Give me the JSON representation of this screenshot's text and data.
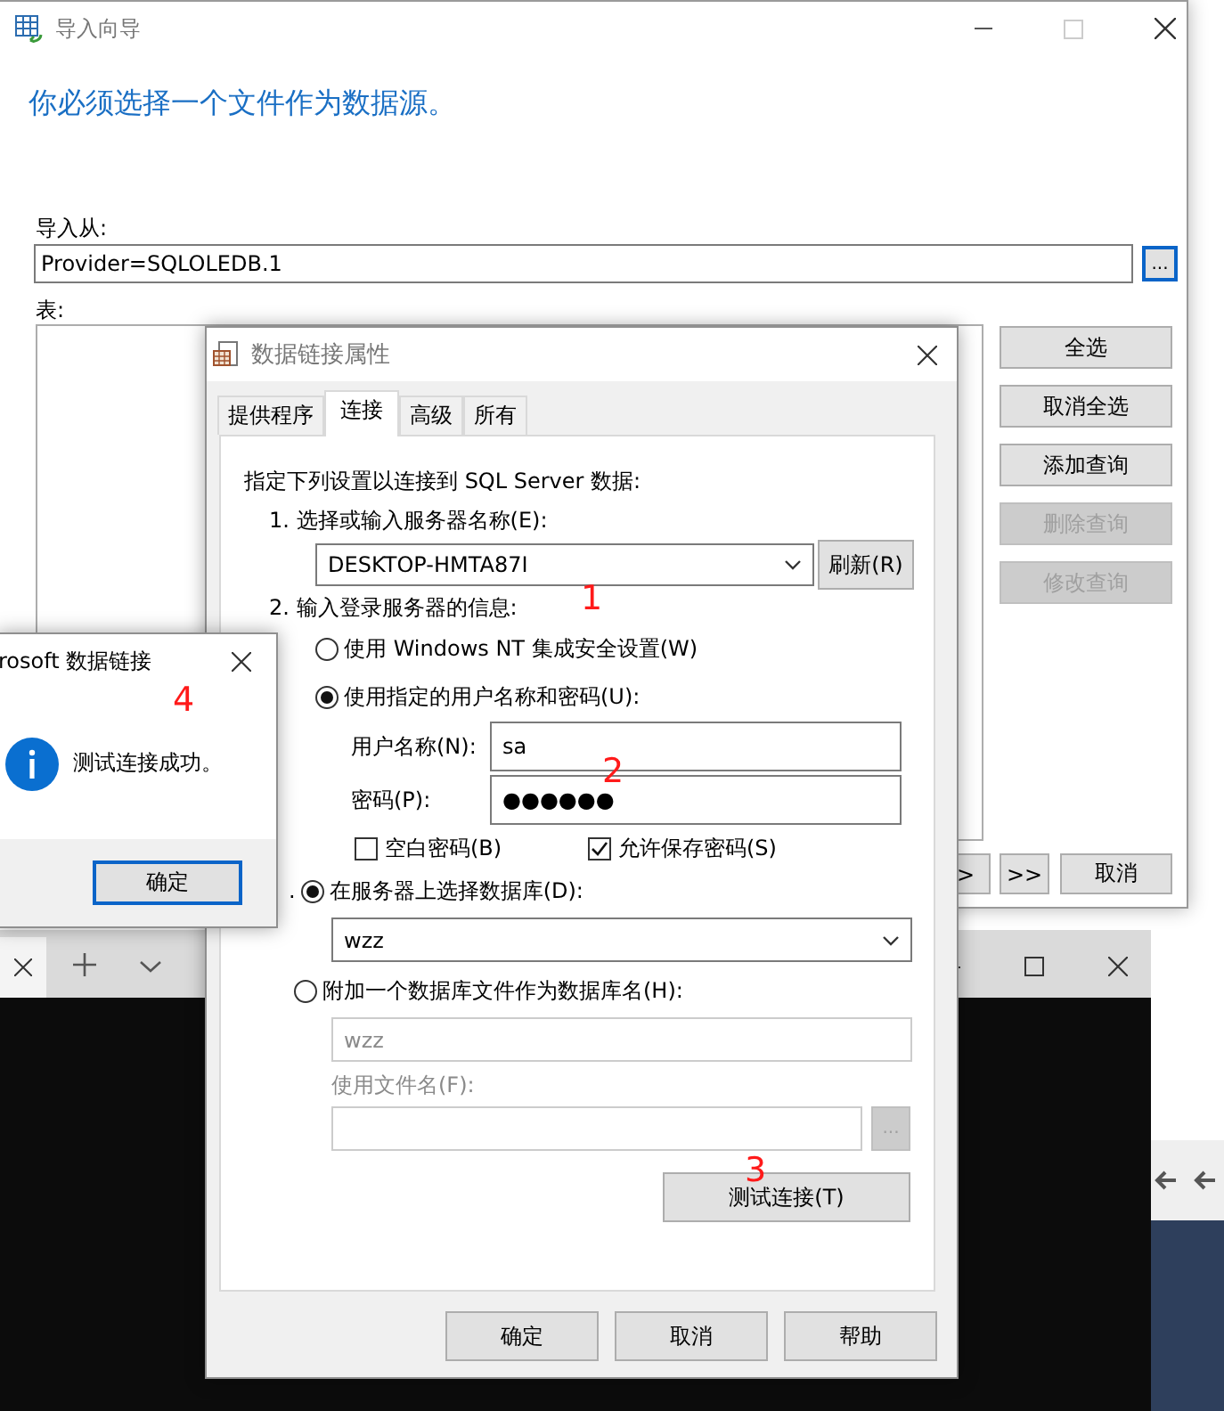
{
  "import_wizard": {
    "title": "导入向导",
    "heading": "你必须选择一个文件作为数据源。",
    "source_label": "导入从:",
    "source_value": "Provider=SQLOLEDB.1",
    "browse_button": "...",
    "table_label": "表:",
    "side_buttons": [
      {
        "label": "全选",
        "disabled": false
      },
      {
        "label": "取消全选",
        "disabled": false
      },
      {
        "label": "添加查询",
        "disabled": false
      },
      {
        "label": "删除查询",
        "disabled": true
      },
      {
        "label": "修改查询",
        "disabled": true
      }
    ],
    "nav_buttons": [
      ">",
      ">>",
      "取消"
    ]
  },
  "data_link_dialog": {
    "title": "数据链接属性",
    "tabs": [
      {
        "label": "提供程序",
        "selected": false
      },
      {
        "label": "连接",
        "selected": true
      },
      {
        "label": "高级",
        "selected": false
      },
      {
        "label": "所有",
        "selected": false
      }
    ],
    "intro": "指定下列设置以连接到 SQL Server 数据:",
    "step1_label": "1. 选择或输入服务器名称(E):",
    "server": "DESKTOP-HMTA87I",
    "refresh_button": "刷新(R)",
    "step2_label": "2. 输入登录服务器的信息:",
    "auth_options": [
      {
        "label": "使用 Windows NT 集成安全设置(W)",
        "selected": false
      },
      {
        "label": "使用指定的用户名称和密码(U):",
        "selected": true
      }
    ],
    "username_label": "用户名称(N):",
    "username": "sa",
    "password_label": "密码(P):",
    "password": "●●●●●●",
    "checkboxes": [
      {
        "label": "空白密码(B)",
        "checked": false
      },
      {
        "label": "允许保存密码(S)",
        "checked": true
      }
    ],
    "step3_prefix": ".",
    "db_options": [
      {
        "label": "在服务器上选择数据库(D):",
        "selected": true
      },
      {
        "label": "附加一个数据库文件作为数据库名(H):",
        "selected": false
      }
    ],
    "database": "wzz",
    "attach_name": "wzz",
    "attach_disabled": true,
    "filename_label": "使用文件名(F):",
    "filename_browse": "...",
    "test_button": "测试连接(T)",
    "buttons": [
      "确定",
      "取消",
      "帮助"
    ]
  },
  "message_box": {
    "title": "rosoft 数据链接",
    "message": "测试连接成功。",
    "ok_button": "确定"
  },
  "annotations": [
    {
      "text": "1"
    },
    {
      "text": "2"
    },
    {
      "text": "3"
    },
    {
      "text": "4"
    }
  ]
}
